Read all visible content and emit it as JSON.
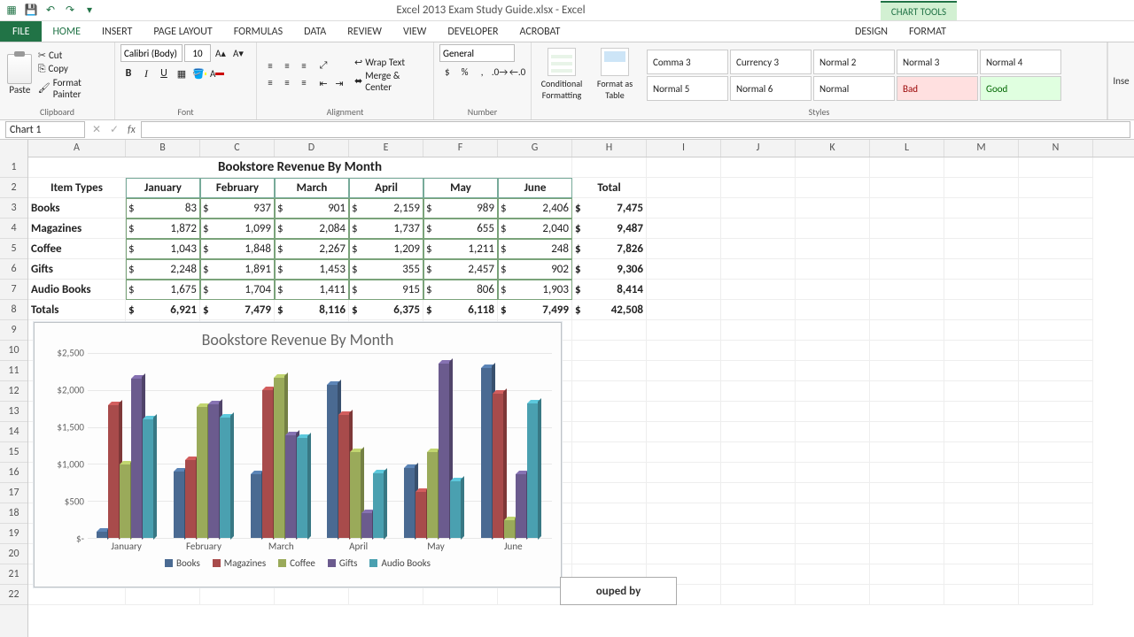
{
  "titlebar": {
    "doc_title": "Excel 2013 Exam Study Guide.xlsx - Excel",
    "chart_tools_label": "CHART TOOLS"
  },
  "ribbon": {
    "tabs": [
      "FILE",
      "HOME",
      "INSERT",
      "PAGE LAYOUT",
      "FORMULAS",
      "DATA",
      "REVIEW",
      "VIEW",
      "DEVELOPER",
      "ACROBAT",
      "DESIGN",
      "FORMAT"
    ],
    "clipboard": {
      "label": "Clipboard",
      "paste": "Paste",
      "cut": "Cut",
      "copy": "Copy",
      "format_painter": "Format Painter"
    },
    "font": {
      "label": "Font",
      "name": "Calibri (Body)",
      "size": "10"
    },
    "alignment": {
      "label": "Alignment",
      "wrap": "Wrap Text",
      "merge": "Merge & Center"
    },
    "number": {
      "label": "Number",
      "format": "General"
    },
    "styles": {
      "label": "Styles",
      "cond": "Conditional Formatting",
      "table": "Format as Table",
      "cells": [
        "Comma 3",
        "Currency 3",
        "Normal 2",
        "Normal 3",
        "Normal 4",
        "Normal 5",
        "Normal 6",
        "Normal",
        "Bad",
        "Good"
      ]
    },
    "insert_stub": "Inse"
  },
  "formula_bar": {
    "name_box": "Chart 1",
    "fx": "fx"
  },
  "columns": [
    "A",
    "B",
    "C",
    "D",
    "E",
    "F",
    "G",
    "H",
    "I",
    "J",
    "K",
    "L",
    "M",
    "N"
  ],
  "rows_visible": 22,
  "table": {
    "title": "Bookstore Revenue By Month",
    "col_headers": [
      "Item Types",
      "January",
      "February",
      "March",
      "April",
      "May",
      "June",
      "Total"
    ],
    "rows": [
      {
        "label": "Books",
        "vals": [
          "83",
          "937",
          "901",
          "2,159",
          "989",
          "2,406"
        ],
        "total": "7,475"
      },
      {
        "label": "Magazines",
        "vals": [
          "1,872",
          "1,099",
          "2,084",
          "1,737",
          "655",
          "2,040"
        ],
        "total": "9,487"
      },
      {
        "label": "Coffee",
        "vals": [
          "1,043",
          "1,848",
          "2,267",
          "1,209",
          "1,211",
          "248"
        ],
        "total": "7,826"
      },
      {
        "label": "Gifts",
        "vals": [
          "2,248",
          "1,891",
          "1,453",
          "355",
          "2,457",
          "902"
        ],
        "total": "9,306"
      },
      {
        "label": "Audio Books",
        "vals": [
          "1,675",
          "1,704",
          "1,411",
          "915",
          "806",
          "1,903"
        ],
        "total": "8,414"
      }
    ],
    "totals": {
      "label": "Totals",
      "vals": [
        "6,921",
        "7,479",
        "8,116",
        "6,375",
        "6,118",
        "7,499"
      ],
      "grand": "42,508"
    }
  },
  "chart_data": {
    "type": "bar",
    "title": "Bookstore Revenue By Month",
    "categories": [
      "January",
      "February",
      "March",
      "April",
      "May",
      "June"
    ],
    "series": [
      {
        "name": "Books",
        "color": "#4a6a92",
        "values": [
          83,
          937,
          901,
          2159,
          989,
          2406
        ]
      },
      {
        "name": "Magazines",
        "color": "#a84b4b",
        "values": [
          1872,
          1099,
          2084,
          1737,
          655,
          2040
        ]
      },
      {
        "name": "Coffee",
        "color": "#9aaa5a",
        "values": [
          1043,
          1848,
          2267,
          1209,
          1211,
          248
        ]
      },
      {
        "name": "Gifts",
        "color": "#6b5b8e",
        "values": [
          2248,
          1891,
          1453,
          355,
          2457,
          902
        ]
      },
      {
        "name": "Audio Books",
        "color": "#4aa0b0",
        "values": [
          1675,
          1704,
          1411,
          915,
          806,
          1903
        ]
      }
    ],
    "y_ticks": [
      "$2,500",
      "$2,000",
      "$1,500",
      "$1,000",
      "$500",
      "$-"
    ],
    "ylim": [
      0,
      2500
    ]
  },
  "snippet_text": "ouped by"
}
